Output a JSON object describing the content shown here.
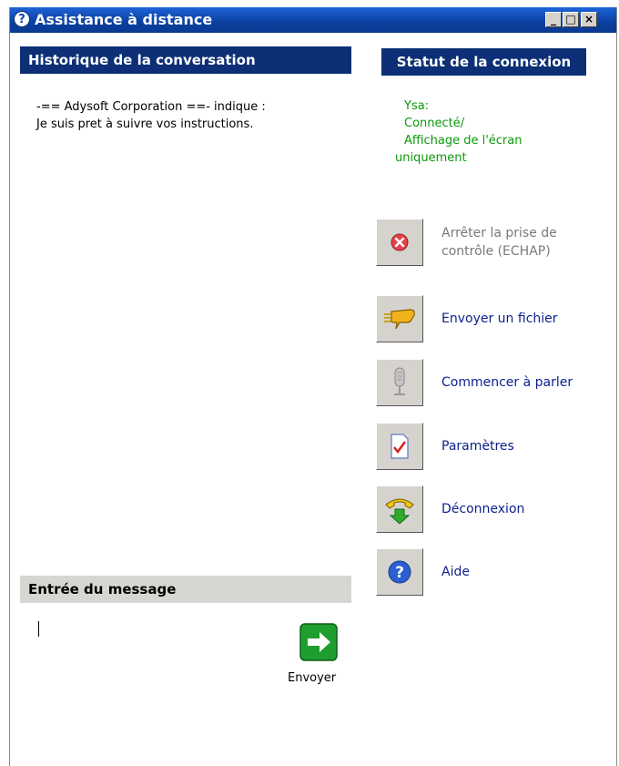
{
  "window": {
    "title": "Assistance à distance",
    "controls": {
      "minimize": "_",
      "maximize": "□",
      "close": "×"
    }
  },
  "history": {
    "title": "Historique de la conversation",
    "messages": [
      "-== Adysoft Corporation ==- indique :",
      "Je suis pret à suivre vos instructions."
    ]
  },
  "status": {
    "title": "Statut de la connexion",
    "lines": [
      "Ysa:",
      "Connecté/",
      "Affichage de l'écran",
      "uniquement"
    ]
  },
  "actions": [
    {
      "label_line1": "Arrêter la prise de",
      "label_line2": "contrôle (ECHAP)",
      "icon": "stop-icon",
      "disabled": true
    },
    {
      "label": "Envoyer un fichier",
      "icon": "send-file-icon"
    },
    {
      "label": "Commencer à parler",
      "icon": "microphone-icon"
    },
    {
      "label": "Paramètres",
      "icon": "settings-checklist-icon"
    },
    {
      "label": "Déconnexion",
      "icon": "disconnect-phone-icon"
    },
    {
      "label": "Aide",
      "icon": "help-icon"
    }
  ],
  "message_entry": {
    "title": "Entrée du message",
    "value": "",
    "send_label": "Envoyer"
  }
}
